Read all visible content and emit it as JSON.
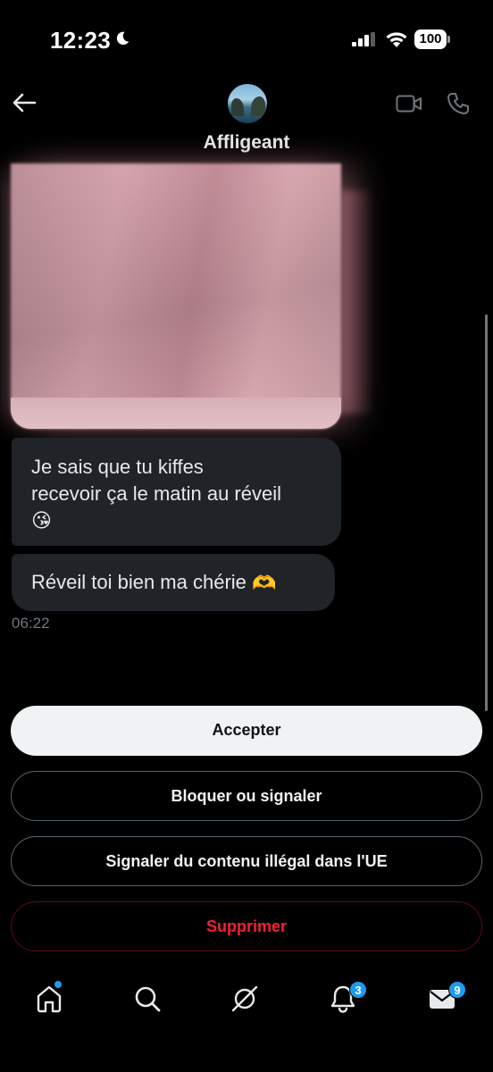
{
  "status_bar": {
    "time": "12:23",
    "battery": "100"
  },
  "header": {
    "contact_name": "Affligeant"
  },
  "messages": [
    {
      "text_line1": "Je sais que tu kiffes",
      "text_line2": "recevoir ça le matin au réveil",
      "emoji": "😘"
    },
    {
      "text": "Réveil toi bien ma chérie",
      "emoji": "🫶"
    }
  ],
  "message_time": "06:22",
  "actions": {
    "accept": "Accepter",
    "block": "Bloquer ou signaler",
    "report_illegal": "Signaler du contenu illégal dans l'UE",
    "delete": "Supprimer"
  },
  "nav": {
    "notifications_badge": "3",
    "messages_badge": "9"
  },
  "colors": {
    "accent": "#1d9bf0",
    "danger": "#f4212e",
    "bubble": "#202327"
  },
  "icons": [
    "back-arrow-icon",
    "video-call-icon",
    "phone-icon",
    "home-icon",
    "search-icon",
    "grok-icon",
    "bell-icon",
    "mail-icon"
  ]
}
